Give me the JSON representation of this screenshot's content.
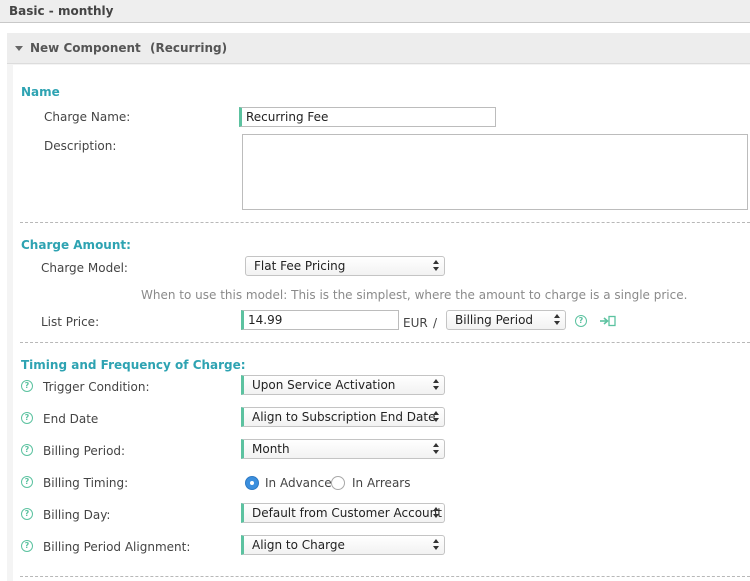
{
  "plan": {
    "title": "Basic - monthly"
  },
  "component": {
    "title": "New Component",
    "type": "(Recurring)"
  },
  "sections": {
    "name": "Name",
    "charge_amount": "Charge Amount:",
    "timing": "Timing and Frequency of Charge:"
  },
  "fields": {
    "charge_name": {
      "label": "Charge Name:",
      "value": "Recurring Fee"
    },
    "description": {
      "label": "Description:",
      "value": ""
    },
    "charge_model": {
      "label": "Charge Model:",
      "value": "Flat Fee Pricing",
      "hint": "When to use this model: This is the simplest, where the amount to charge is a single price."
    },
    "list_price": {
      "label": "List Price:",
      "value": "14.99",
      "currency": "EUR",
      "separator": "/",
      "period": "Billing Period"
    },
    "trigger_condition": {
      "label": "Trigger Condition:",
      "value": "Upon Service Activation"
    },
    "end_date": {
      "label": "End Date",
      "value": "Align to Subscription End Date"
    },
    "billing_period": {
      "label": "Billing Period:",
      "value": "Month"
    },
    "billing_timing": {
      "label": "Billing Timing:",
      "options": [
        "In Advance",
        "In Arrears"
      ],
      "selected": "In Advance"
    },
    "billing_day": {
      "label": "Billing Day:",
      "value": "Default from Customer Account"
    },
    "billing_period_alignment": {
      "label": "Billing Period Alignment:",
      "value": "Align to Charge"
    }
  },
  "icons": {
    "help": "help-icon",
    "copy": "copy-to-field-icon",
    "collapse": "collapse-arrow-icon"
  },
  "colors": {
    "accent": "#2ea3b2",
    "required_marker": "#5cc2a0",
    "radio_selected": "#3b8fde"
  }
}
